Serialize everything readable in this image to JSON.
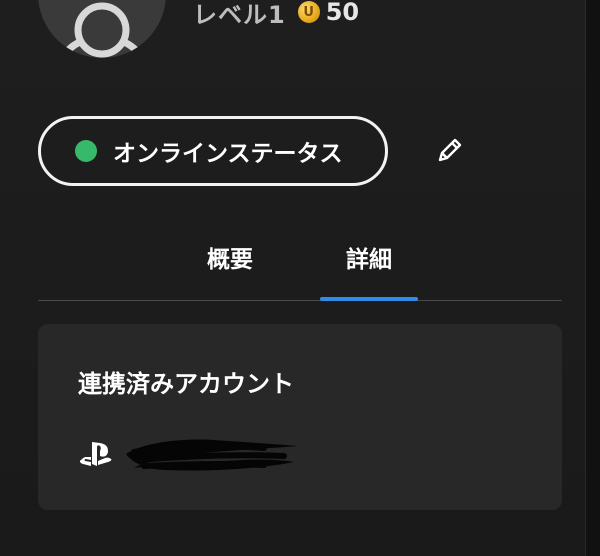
{
  "profile": {
    "level_label": "レベル1",
    "coin_symbol": "U",
    "coin_value": "50"
  },
  "status": {
    "label": "オンラインステータス",
    "dot_color": "#37b96b",
    "edit_icon": "pencil-icon"
  },
  "tabs": [
    {
      "label": "概要",
      "active": false
    },
    {
      "label": "詳細",
      "active": true
    }
  ],
  "tab_indicator_color": "#2f8ce8",
  "linked_accounts": {
    "title": "連携済みアカウント",
    "items": [
      {
        "icon": "playstation-icon",
        "value_redacted": true
      }
    ]
  }
}
